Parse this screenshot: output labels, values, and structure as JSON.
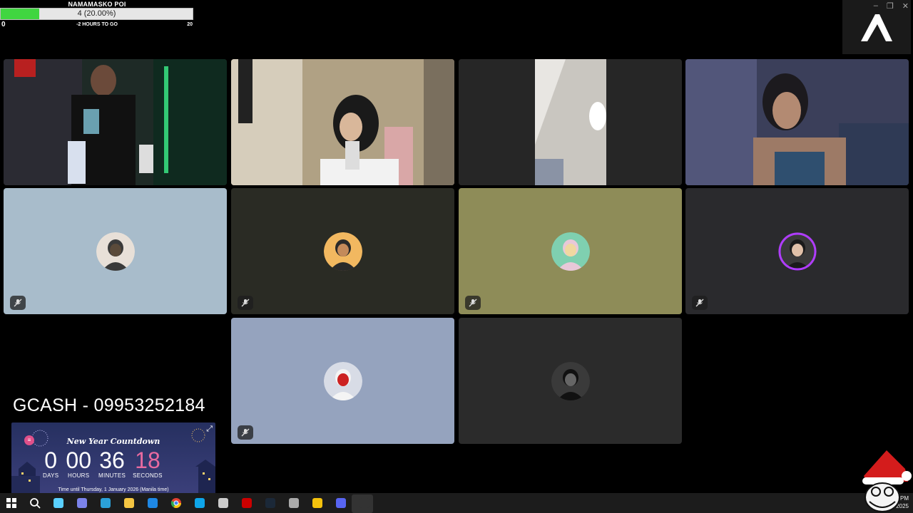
{
  "goal": {
    "title": "NAMAMASKO POI",
    "progress_text": "4 (20.00%)",
    "progress_fraction": 0.2,
    "min": "0",
    "max": "20",
    "subtitle": "-2 HOURS TO GO"
  },
  "window": {
    "minimize": "–",
    "maximize": "❐",
    "close": "✕"
  },
  "tiles": [
    {
      "name": "participant-video-1",
      "kind": "video"
    },
    {
      "name": "participant-video-2",
      "kind": "video"
    },
    {
      "name": "participant-video-3",
      "kind": "video"
    },
    {
      "name": "participant-video-4",
      "kind": "video"
    },
    {
      "name": "participant-5",
      "kind": "avatar",
      "bg": "#a8bccb",
      "muted": true
    },
    {
      "name": "participant-6",
      "kind": "avatar",
      "bg": "#2a2b24",
      "muted": true
    },
    {
      "name": "participant-7",
      "kind": "avatar",
      "bg": "#8e8c58",
      "muted": true
    },
    {
      "name": "participant-8",
      "kind": "avatar",
      "bg": "#2a2a2d",
      "muted": true,
      "speaking": true
    },
    {
      "name": "participant-9",
      "kind": "avatar",
      "bg": "#95a3be",
      "muted": true
    },
    {
      "name": "participant-10",
      "kind": "avatar",
      "bg": "#2b2b2b",
      "muted": false
    }
  ],
  "overlay": {
    "gcash": "GCASH - 09953252184"
  },
  "countdown": {
    "title": "New Year Countdown",
    "days": "0",
    "days_label": "DAYS",
    "hours": "00",
    "hours_label": "HOURS",
    "minutes": "36",
    "minutes_label": "MINUTES",
    "seconds": "18",
    "seconds_label": "SECONDS",
    "footer": "Time until Thursday, 1 January 2026 (Manila time)"
  },
  "taskbar": {
    "icons": [
      "windows-start-icon",
      "search-icon",
      "copilot-icon",
      "teams-icon",
      "edge-icon",
      "file-explorer-icon",
      "outlook-icon",
      "chrome-icon",
      "store-icon",
      "app-icon",
      "video-editor-icon",
      "steam-icon",
      "app-grid-icon",
      "obs-tool-icon",
      "discord-icon",
      "obs-icon"
    ],
    "time": "11:23 PM",
    "date": "31/12/2025"
  },
  "colors": {
    "goal_fill": "#40d640",
    "speaking_ring": "#b03cff",
    "countdown_pink": "#e86aa0"
  }
}
